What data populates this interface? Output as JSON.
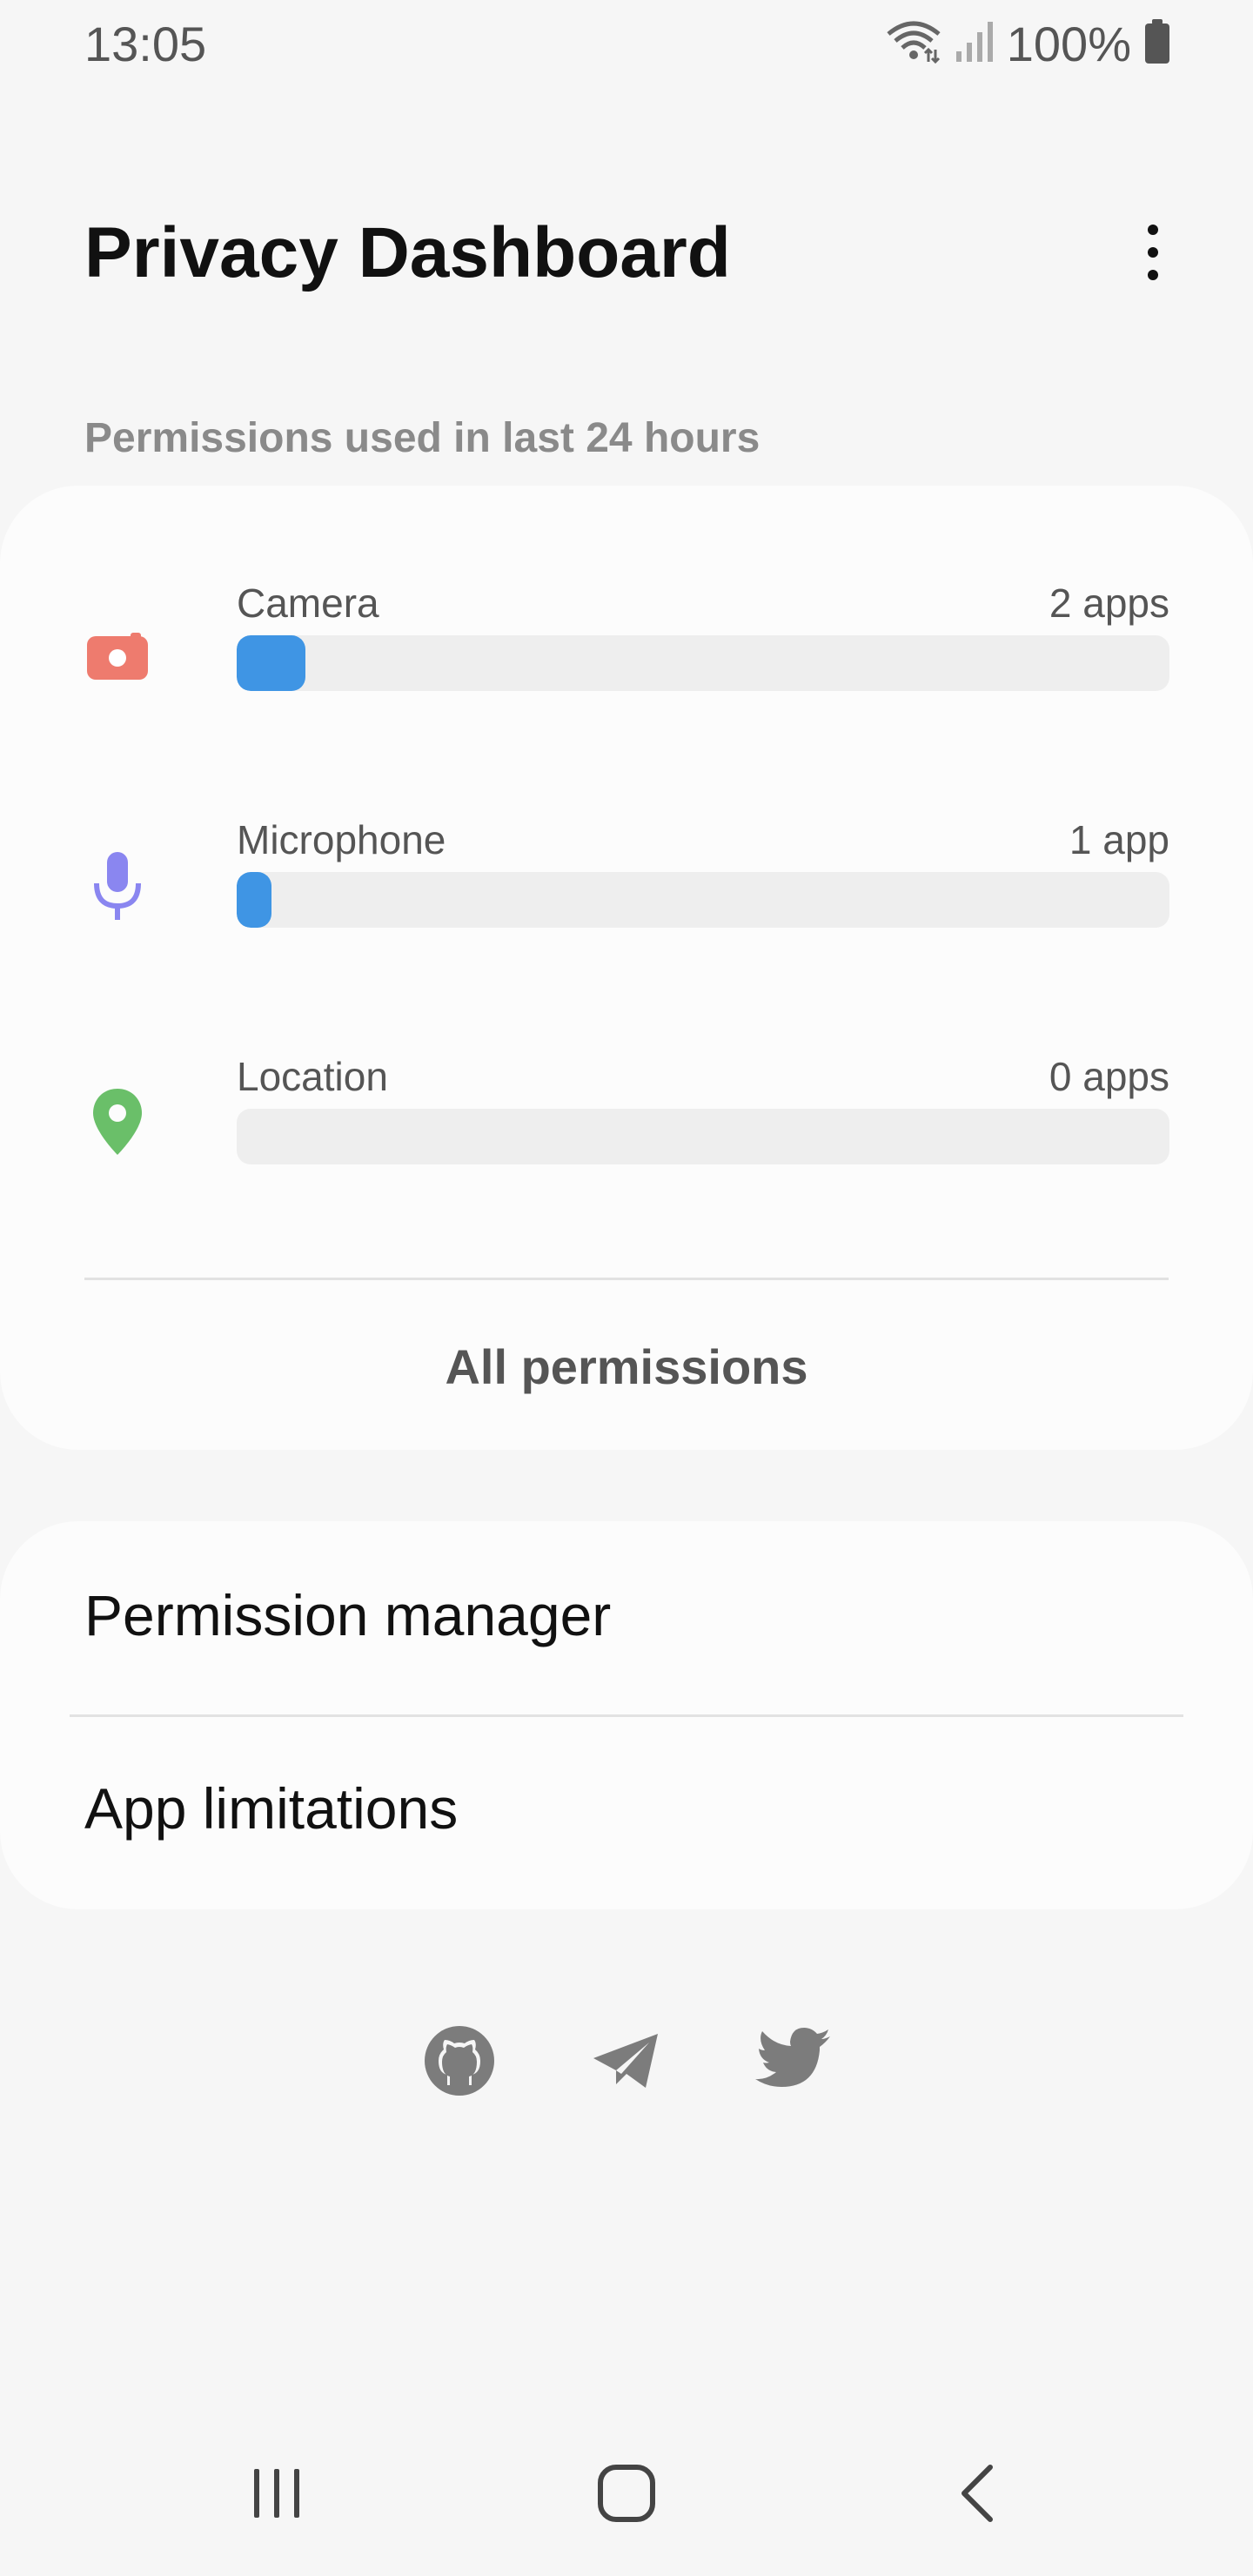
{
  "status_bar": {
    "time": "13:05",
    "battery_text": "100%",
    "icons": [
      "wifi-icon",
      "signal-icon",
      "battery-icon"
    ]
  },
  "header": {
    "title": "Privacy Dashboard",
    "more_icon": "more-vert-icon"
  },
  "usage": {
    "caption": "Permissions used in last 24 hours",
    "permissions": [
      {
        "label": "Camera",
        "count": "2 apps",
        "icon": "camera-icon",
        "icon_color": "#ee7b6e",
        "fill_fraction": 0.074
      },
      {
        "label": "Microphone",
        "count": "1 app",
        "icon": "microphone-icon",
        "icon_color": "#8a86f0",
        "fill_fraction": 0.037
      },
      {
        "label": "Location",
        "count": "0 apps",
        "icon": "location-icon",
        "icon_color": "#6abf69",
        "fill_fraction": 0
      }
    ],
    "all_permissions_label": "All permissions",
    "bar_color": "#3f95e4"
  },
  "links": {
    "items": [
      {
        "label": "Permission manager"
      },
      {
        "label": "App limitations"
      }
    ]
  },
  "social": {
    "icons": [
      "github-icon",
      "telegram-icon",
      "twitter-icon"
    ]
  },
  "nav_bar": {
    "icons": [
      "recents-icon",
      "home-icon",
      "back-icon"
    ]
  }
}
